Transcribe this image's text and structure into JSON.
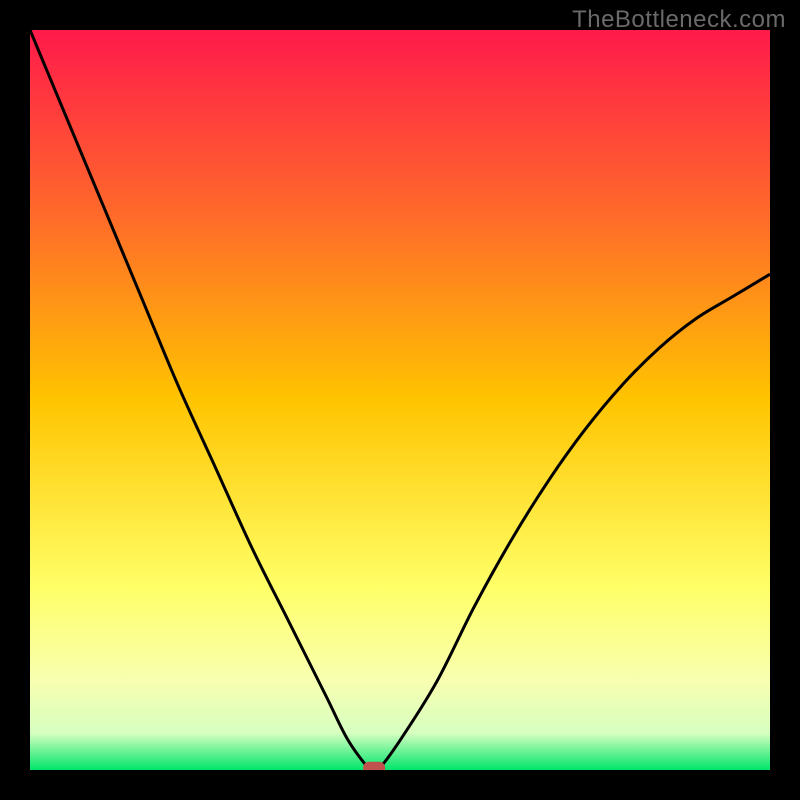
{
  "watermark": "TheBottleneck.com",
  "chart_data": {
    "type": "line",
    "title": "",
    "xlabel": "",
    "ylabel": "",
    "xlim": [
      0,
      100
    ],
    "ylim": [
      0,
      100
    ],
    "series": [
      {
        "name": "curve",
        "x": [
          0,
          5,
          10,
          15,
          20,
          25,
          30,
          35,
          40,
          43,
          46,
          47,
          50,
          55,
          60,
          65,
          70,
          75,
          80,
          85,
          90,
          95,
          100
        ],
        "values": [
          100,
          88,
          76,
          64,
          52,
          41,
          30,
          20,
          10,
          4,
          0,
          0,
          4,
          12,
          22,
          31,
          39,
          46,
          52,
          57,
          61,
          64,
          67
        ]
      }
    ],
    "gradient_stops": [
      {
        "offset": 0.0,
        "color": "#ff1a4b"
      },
      {
        "offset": 0.25,
        "color": "#ff6a2a"
      },
      {
        "offset": 0.5,
        "color": "#ffc400"
      },
      {
        "offset": 0.75,
        "color": "#ffff66"
      },
      {
        "offset": 0.88,
        "color": "#f8ffb0"
      },
      {
        "offset": 0.95,
        "color": "#d6ffc0"
      },
      {
        "offset": 1.0,
        "color": "#00e56b"
      }
    ],
    "marker": {
      "x": 46.5,
      "y": 0.3,
      "color": "#c0524d"
    }
  }
}
